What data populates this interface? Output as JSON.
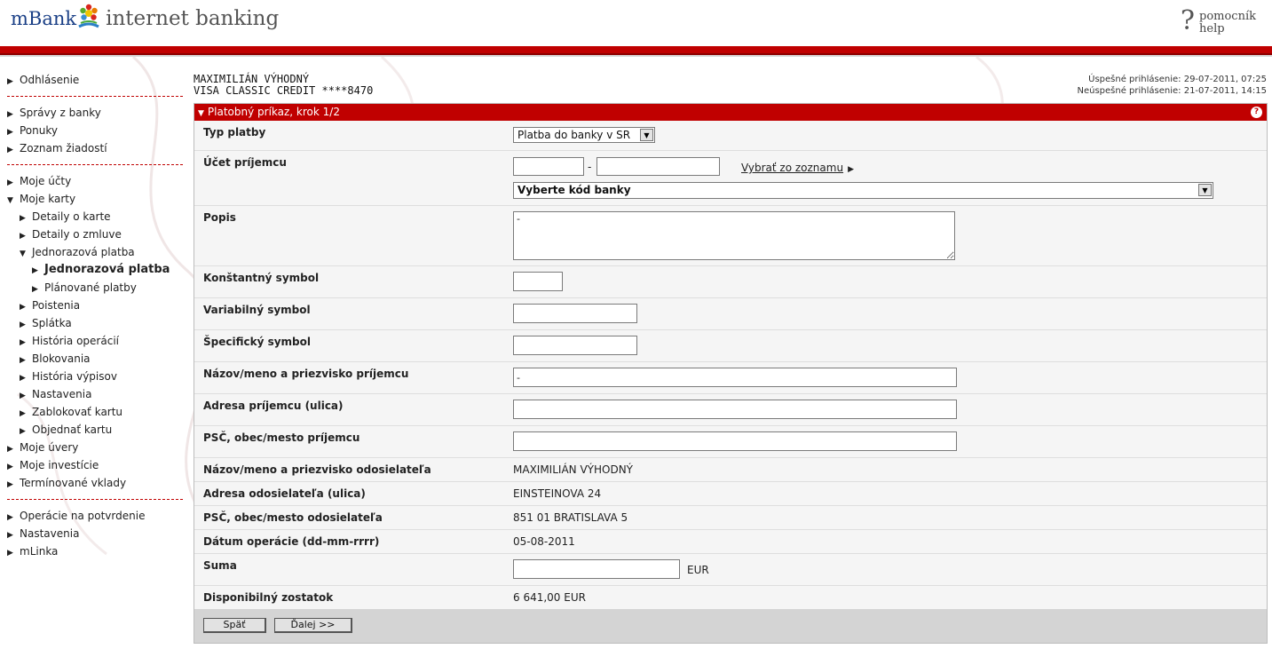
{
  "header": {
    "brand": "mBank",
    "product": "internet banking",
    "help_line1": "pomocník",
    "help_line2": "help",
    "help_glyph": "?",
    "accent_color": "#c00000"
  },
  "sidebar": {
    "group1": [
      {
        "label": "Odhlásenie"
      }
    ],
    "group2": [
      {
        "label": "Správy z banky"
      },
      {
        "label": "Ponuky"
      },
      {
        "label": "Zoznam žiadostí"
      }
    ],
    "group3": {
      "moje_ucty": "Moje účty",
      "moje_karty": "Moje karty",
      "cards": [
        {
          "label": "Detaily o karte"
        },
        {
          "label": "Detaily o zmluve"
        },
        {
          "label": "Jednorazová platba"
        }
      ],
      "payment_sub": [
        {
          "label": "Jednorazová platba"
        },
        {
          "label": "Plánované platby"
        }
      ],
      "cards2": [
        {
          "label": "Poistenia"
        },
        {
          "label": "Splátka"
        },
        {
          "label": "História operácií"
        },
        {
          "label": "Blokovania"
        },
        {
          "label": "História výpisov"
        },
        {
          "label": "Nastavenia"
        },
        {
          "label": "Zablokovať kartu"
        },
        {
          "label": "Objednať kartu"
        }
      ],
      "after": [
        {
          "label": "Moje úvery"
        },
        {
          "label": "Moje investície"
        },
        {
          "label": "Termínované vklady"
        }
      ]
    },
    "group4": [
      {
        "label": "Operácie na potvrdenie"
      },
      {
        "label": "Nastavenia"
      },
      {
        "label": "mLinka"
      }
    ]
  },
  "account": {
    "holder": "MAXIMILIÁN VÝHODNÝ",
    "card": "VISA CLASSIC CREDIT ****8470"
  },
  "login": {
    "success": "Úspešné prihlásenie: 29-07-2011, 07:25",
    "failed": "Neúspešné prihlásenie: 21-07-2011, 14:15"
  },
  "panel": {
    "title": "Platobný príkaz, krok 1/2",
    "help_glyph": "?"
  },
  "form": {
    "typ_platby": {
      "label": "Typ platby",
      "value": "Platba do banky v SR"
    },
    "ucet_prijemcu": {
      "label": "Účet príjemcu",
      "separator": "-",
      "prefix": "",
      "number": "",
      "link": "Vybrať zo zoznamu",
      "bank_select": "Vyberte kód banky"
    },
    "popis": {
      "label": "Popis",
      "value": "-"
    },
    "konst_symbol": {
      "label": "Konštantný symbol",
      "value": ""
    },
    "var_symbol": {
      "label": "Variabilný symbol",
      "value": ""
    },
    "spec_symbol": {
      "label": "Špecifický symbol",
      "value": ""
    },
    "nazov_prijemcu": {
      "label": "Názov/meno a priezvisko príjemcu",
      "value": "-"
    },
    "adresa_prijemcu": {
      "label": "Adresa príjemcu (ulica)",
      "value": ""
    },
    "psc_prijemcu": {
      "label": "PSČ, obec/mesto príjemcu",
      "value": ""
    },
    "nazov_odosielatela": {
      "label": "Názov/meno a priezvisko odosielateľa",
      "value": "MAXIMILIÁN VÝHODNÝ"
    },
    "adresa_odosielatela": {
      "label": "Adresa odosielateľa (ulica)",
      "value": "EINSTEINOVA 24"
    },
    "psc_odosielatela": {
      "label": "PSČ, obec/mesto odosielateľa",
      "value": "851 01 BRATISLAVA 5"
    },
    "datum": {
      "label": "Dátum operácie (dd-mm-rrrr)",
      "value": "05-08-2011"
    },
    "suma": {
      "label": "Suma",
      "value": "",
      "currency": "EUR"
    },
    "zostatok": {
      "label": "Disponibilný zostatok",
      "value": "6 641,00 EUR"
    }
  },
  "buttons": {
    "back": "Späť",
    "next": "Ďalej >>"
  }
}
